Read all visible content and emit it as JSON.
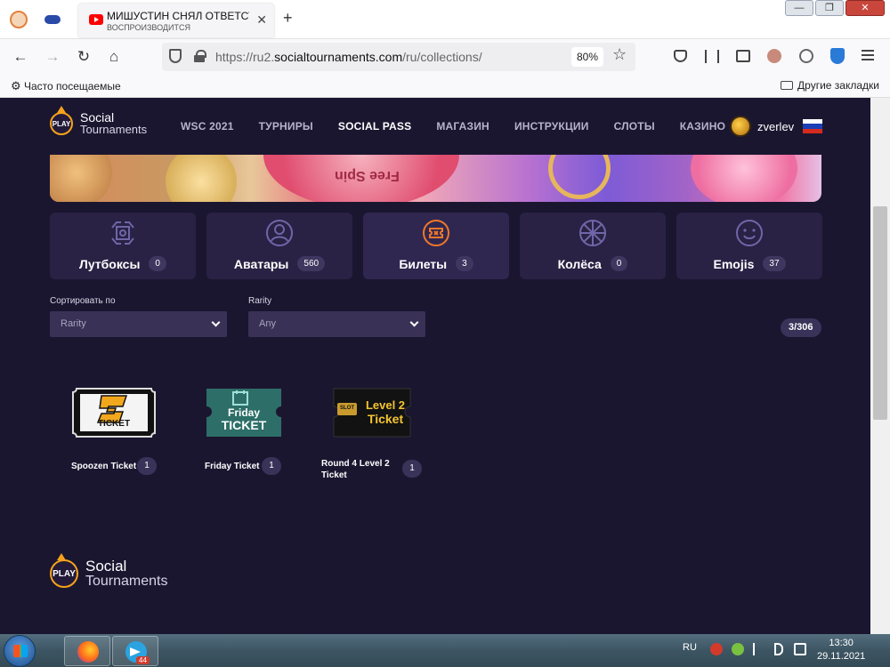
{
  "browser": {
    "tab": {
      "title": "МИШУСТИН СНЯЛ ОТВЕТСТВЕ",
      "subtitle": "ВОСПРОИЗВОДИТСЯ",
      "close": "✕"
    },
    "new_tab": "+",
    "window_buttons": {
      "minimize": "—",
      "maximize": "❐",
      "close": "✕"
    },
    "nav": {
      "back": "←",
      "forward": "→",
      "reload": "↻",
      "home": "⌂"
    },
    "url_prefix": "https://ru2.",
    "url_domain": "socialtournaments.com",
    "url_path": "/ru/collections/",
    "zoom": "80%",
    "bookmark_star": "☆",
    "bookmarks_left": "Часто посещаемые",
    "bookmarks_right": "Другие закладки"
  },
  "site": {
    "logo": {
      "badge": "PLAY",
      "line1": "Social",
      "line2": "Tournaments"
    },
    "nav": [
      {
        "label": "WSC 2021",
        "active": false
      },
      {
        "label": "ТУРНИРЫ",
        "active": false
      },
      {
        "label": "SOCIAL PASS",
        "active": true
      },
      {
        "label": "МАГАЗИН",
        "active": false
      },
      {
        "label": "ИНСТРУКЦИИ",
        "active": false
      },
      {
        "label": "СЛОТЫ",
        "active": false
      },
      {
        "label": "КАЗИНО",
        "active": false
      }
    ],
    "user": {
      "name": "zverlev"
    },
    "banner_text": "Free Spin",
    "categories": [
      {
        "label": "Лутбоксы",
        "count": "0",
        "icon": "lootbox-icon"
      },
      {
        "label": "Аватары",
        "count": "560",
        "icon": "avatar-icon"
      },
      {
        "label": "Билеты",
        "count": "3",
        "icon": "ticket-icon",
        "active": true
      },
      {
        "label": "Колёса",
        "count": "0",
        "icon": "wheel-icon"
      },
      {
        "label": "Emojis",
        "count": "37",
        "icon": "emoji-icon"
      }
    ],
    "filters": {
      "sort_label": "Сортировать по",
      "sort_value": "Rarity",
      "rarity_label": "Rarity",
      "rarity_value": "Any"
    },
    "total": "3/306",
    "items": [
      {
        "name": "Spoozen Ticket",
        "count": "1",
        "art_text": "TICKET",
        "art_letter": "S"
      },
      {
        "name": "Friday Ticket",
        "count": "1",
        "art_text": "Friday",
        "art_text2": "TICKET"
      },
      {
        "name": "Round 4 Level 2 Ticket",
        "count": "1",
        "art_text": "Level 2",
        "art_text2": "Ticket",
        "art_badge": "SLOT"
      }
    ]
  },
  "taskbar": {
    "telegram_badge": "44",
    "lang": "RU",
    "time": "13:30",
    "date": "29.11.2021"
  },
  "colors": {
    "page_bg": "#1b1630",
    "card_bg": "#292244",
    "accent_orange": "#f5a21b",
    "active_icon": "#f0772a"
  }
}
